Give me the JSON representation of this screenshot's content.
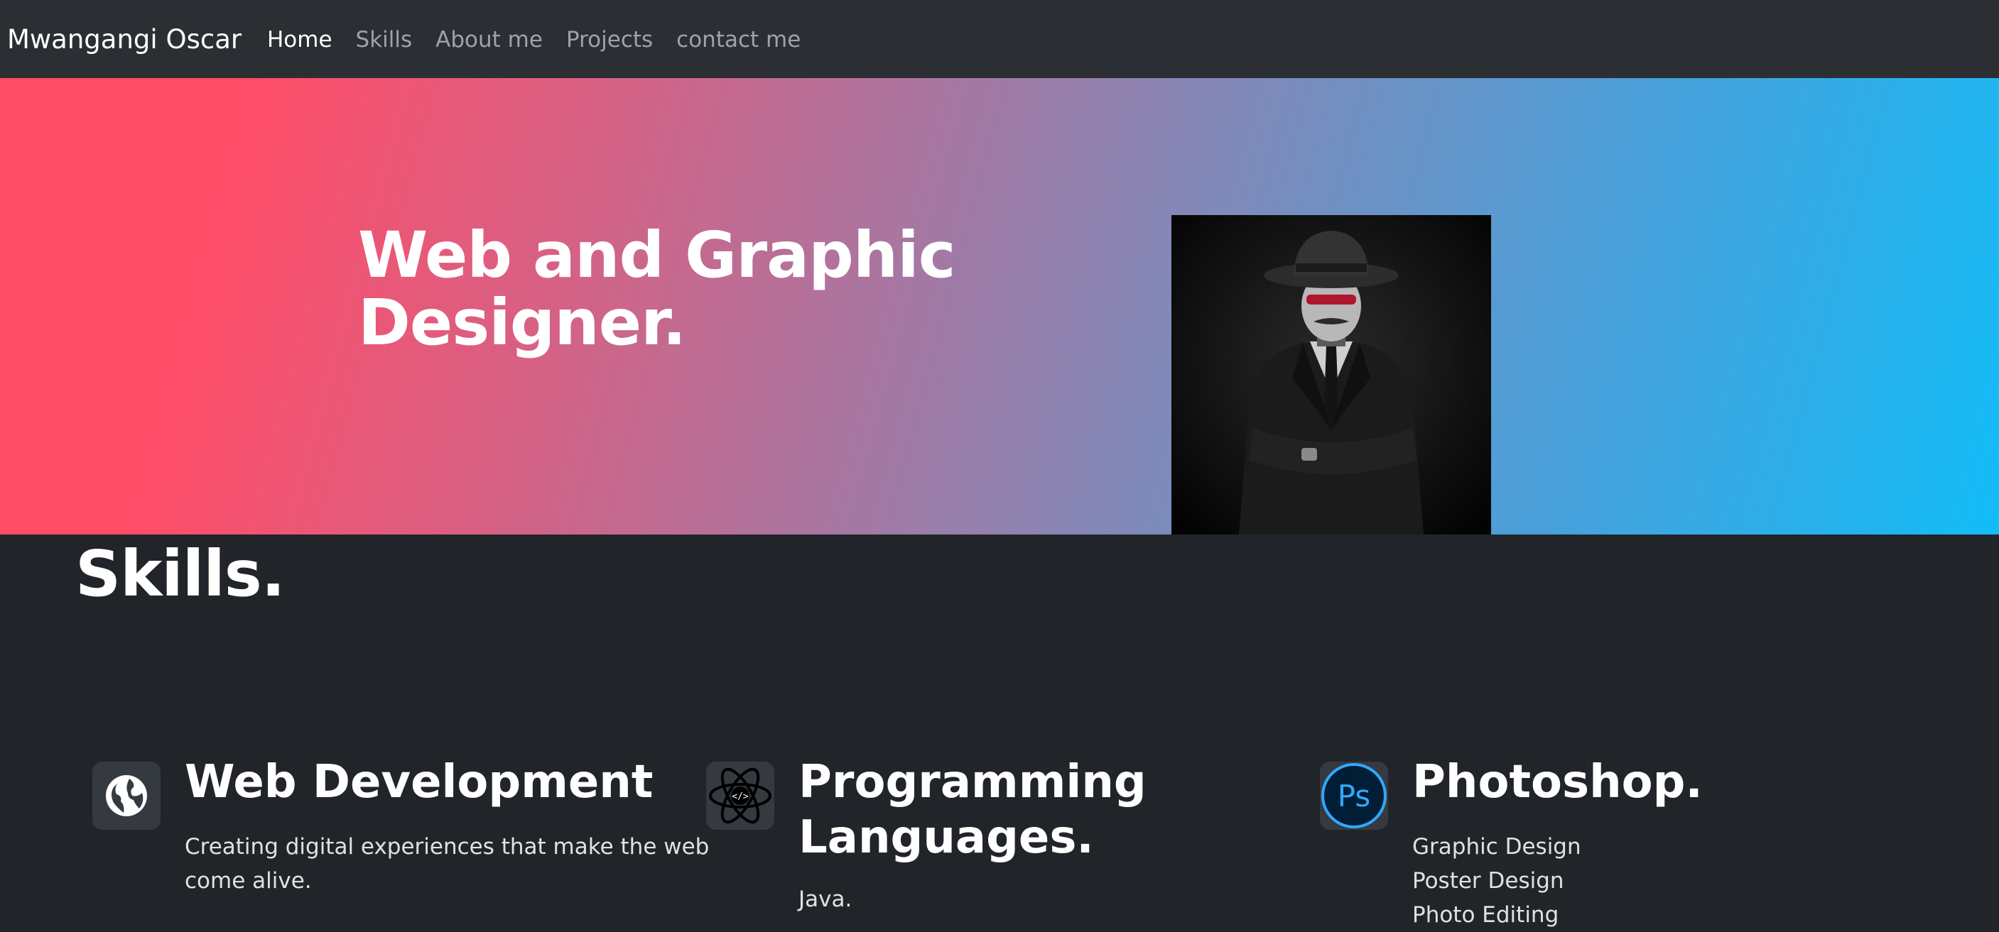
{
  "nav": {
    "brand": "Mwangangi Oscar",
    "links": [
      {
        "label": "Home",
        "active": true
      },
      {
        "label": "Skills",
        "active": false
      },
      {
        "label": "About me",
        "active": false
      },
      {
        "label": "Projects",
        "active": false
      },
      {
        "label": "contact me",
        "active": false
      }
    ]
  },
  "hero": {
    "title": "Web and Graphic Designer.",
    "image_icon": "anonymous-man-in-suit-image"
  },
  "skills": {
    "title": "Skills.",
    "items": [
      {
        "icon": "globe-icon",
        "heading": "Web Development",
        "lines": [
          "Creating digital experiences that make the web",
          "come alive."
        ]
      },
      {
        "icon": "atom-code-icon",
        "heading": "Programming Languages.",
        "lines": [
          "Java."
        ]
      },
      {
        "icon": "photoshop-icon",
        "heading": "Photoshop.",
        "lines": [
          "Graphic Design",
          "Poster Design",
          "Photo Editing"
        ]
      }
    ]
  },
  "colors": {
    "navbar": "#2b2f34",
    "page_bg": "#212529",
    "gradient_start": "#ff4d68",
    "gradient_end": "#12bcf7",
    "photoshop_blue": "#31a8ff"
  }
}
